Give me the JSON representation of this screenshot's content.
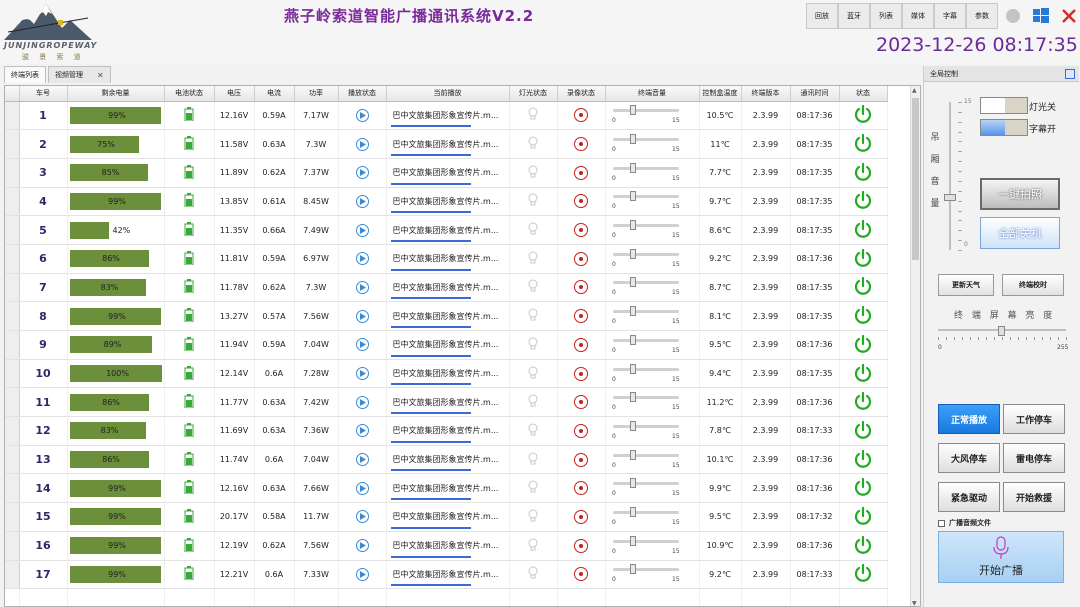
{
  "app": {
    "title": "燕子岭索道智能广播通讯系统V2.2",
    "datetime": "2023-12-26 08:17:35",
    "logo_text": "JUNJINGROPEWAY",
    "logo_sub": "骏 景 索 道"
  },
  "topbar": {
    "buttons": [
      "回放",
      "蓝牙",
      "列表",
      "媒体",
      "字幕",
      "参数"
    ]
  },
  "tabs": [
    {
      "label": "终端列表"
    },
    {
      "label": "视频管理"
    }
  ],
  "table": {
    "columns": [
      "车号",
      "剩余电量",
      "电池状态",
      "电压",
      "电流",
      "功率",
      "播放状态",
      "当前播放",
      "灯光状态",
      "录像状态",
      "终端音量",
      "控制盒温度",
      "终端版本",
      "通讯时间",
      "状态"
    ],
    "rows": [
      {
        "no": "1",
        "battery": "99%",
        "pct": 99,
        "voltage": "12.16V",
        "current": "0.59A",
        "power": "7.17W",
        "playing": "巴中文旅集团形象宣传片.m...",
        "temp": "10.5℃",
        "version": "2.3.99",
        "time": "08:17:36"
      },
      {
        "no": "2",
        "battery": "75%",
        "pct": 75,
        "voltage": "11.58V",
        "current": "0.63A",
        "power": "7.3W",
        "playing": "巴中文旅集团形象宣传片.m...",
        "temp": "11℃",
        "version": "2.3.99",
        "time": "08:17:35"
      },
      {
        "no": "3",
        "battery": "85%",
        "pct": 85,
        "voltage": "11.89V",
        "current": "0.62A",
        "power": "7.37W",
        "playing": "巴中文旅集团形象宣传片.m...",
        "temp": "7.7℃",
        "version": "2.3.99",
        "time": "08:17:35"
      },
      {
        "no": "4",
        "battery": "99%",
        "pct": 99,
        "voltage": "13.85V",
        "current": "0.61A",
        "power": "8.45W",
        "playing": "巴中文旅集团形象宣传片.m...",
        "temp": "9.7℃",
        "version": "2.3.99",
        "time": "08:17:35"
      },
      {
        "no": "5",
        "battery": "42%",
        "pct": 42,
        "voltage": "11.35V",
        "current": "0.66A",
        "power": "7.49W",
        "playing": "巴中文旅集团形象宣传片.m...",
        "temp": "8.6℃",
        "version": "2.3.99",
        "time": "08:17:35"
      },
      {
        "no": "6",
        "battery": "86%",
        "pct": 86,
        "voltage": "11.81V",
        "current": "0.59A",
        "power": "6.97W",
        "playing": "巴中文旅集团形象宣传片.m...",
        "temp": "9.2℃",
        "version": "2.3.99",
        "time": "08:17:36"
      },
      {
        "no": "7",
        "battery": "83%",
        "pct": 83,
        "voltage": "11.78V",
        "current": "0.62A",
        "power": "7.3W",
        "playing": "巴中文旅集团形象宣传片.m...",
        "temp": "8.7℃",
        "version": "2.3.99",
        "time": "08:17:35"
      },
      {
        "no": "8",
        "battery": "99%",
        "pct": 99,
        "voltage": "13.27V",
        "current": "0.57A",
        "power": "7.56W",
        "playing": "巴中文旅集团形象宣传片.m...",
        "temp": "8.1℃",
        "version": "2.3.99",
        "time": "08:17:35"
      },
      {
        "no": "9",
        "battery": "89%",
        "pct": 89,
        "voltage": "11.94V",
        "current": "0.59A",
        "power": "7.04W",
        "playing": "巴中文旅集团形象宣传片.m...",
        "temp": "9.5℃",
        "version": "2.3.99",
        "time": "08:17:36"
      },
      {
        "no": "10",
        "battery": "100%",
        "pct": 100,
        "voltage": "12.14V",
        "current": "0.6A",
        "power": "7.28W",
        "playing": "巴中文旅集团形象宣传片.m...",
        "temp": "9.4℃",
        "version": "2.3.99",
        "time": "08:17:35"
      },
      {
        "no": "11",
        "battery": "86%",
        "pct": 86,
        "voltage": "11.77V",
        "current": "0.63A",
        "power": "7.42W",
        "playing": "巴中文旅集团形象宣传片.m...",
        "temp": "11.2℃",
        "version": "2.3.99",
        "time": "08:17:36"
      },
      {
        "no": "12",
        "battery": "83%",
        "pct": 83,
        "voltage": "11.69V",
        "current": "0.63A",
        "power": "7.36W",
        "playing": "巴中文旅集团形象宣传片.m...",
        "temp": "7.8℃",
        "version": "2.3.99",
        "time": "08:17:33"
      },
      {
        "no": "13",
        "battery": "86%",
        "pct": 86,
        "voltage": "11.74V",
        "current": "0.6A",
        "power": "7.04W",
        "playing": "巴中文旅集团形象宣传片.m...",
        "temp": "10.1℃",
        "version": "2.3.99",
        "time": "08:17:36"
      },
      {
        "no": "14",
        "battery": "99%",
        "pct": 99,
        "voltage": "12.16V",
        "current": "0.63A",
        "power": "7.66W",
        "playing": "巴中文旅集团形象宣传片.m...",
        "temp": "9.9℃",
        "version": "2.3.99",
        "time": "08:17:36"
      },
      {
        "no": "15",
        "battery": "99%",
        "pct": 99,
        "voltage": "20.17V",
        "current": "0.58A",
        "power": "11.7W",
        "playing": "巴中文旅集团形象宣传片.m...",
        "temp": "9.5℃",
        "version": "2.3.99",
        "time": "08:17:32"
      },
      {
        "no": "16",
        "battery": "99%",
        "pct": 99,
        "voltage": "12.19V",
        "current": "0.62A",
        "power": "7.56W",
        "playing": "巴中文旅集团形象宣传片.m...",
        "temp": "10.9℃",
        "version": "2.3.99",
        "time": "08:17:36"
      },
      {
        "no": "17",
        "battery": "99%",
        "pct": 99,
        "voltage": "12.21V",
        "current": "0.6A",
        "power": "7.33W",
        "playing": "巴中文旅集团形象宣传片.m...",
        "temp": "9.2℃",
        "version": "2.3.99",
        "time": "08:17:33"
      }
    ],
    "volume_min": "0",
    "volume_max": "15"
  },
  "panel": {
    "title": "全局控制",
    "cabin_volume_label": [
      "吊",
      "厢",
      "音",
      "量"
    ],
    "cabin_volume_max": "15",
    "cabin_volume_min": "0",
    "light_toggle": "灯光关",
    "subtitle_toggle": "字幕开",
    "photo_button": "一键拍照",
    "all_off_button": "全部关机",
    "weather_button": "更新天气",
    "time_sync_button": "终端校时",
    "brightness_label": "终 端 屏 幕 亮 度",
    "brightness_min": "0",
    "brightness_max": "255",
    "modes": [
      "正常播放",
      "工作停车",
      "大风停车",
      "雷电停车",
      "紧急驱动",
      "开始救援"
    ],
    "audio_file_checkbox": "广播音频文件",
    "broadcast_button": "开始广播"
  },
  "colors": {
    "battery_bar": "#6b8f3a",
    "title_purple": "#7a2a9a",
    "power_green": "#22aa22",
    "record_red": "#c81e1e",
    "selected_blue": "#1a78e0"
  }
}
